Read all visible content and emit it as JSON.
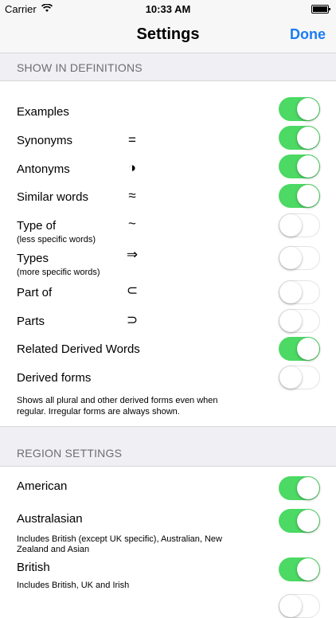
{
  "status_bar": {
    "carrier": "Carrier",
    "time": "10:33 AM"
  },
  "nav": {
    "title": "Settings",
    "done_label": "Done"
  },
  "definitions": {
    "header": "SHOW IN DEFINITIONS",
    "items": [
      {
        "label": "Examples",
        "symbol": "",
        "sub": "",
        "on": true
      },
      {
        "label": "Synonyms",
        "symbol": "=",
        "sub": "",
        "on": true
      },
      {
        "label": "Antonyms",
        "symbol": "◑",
        "sub": "",
        "on": true
      },
      {
        "label": "Similar words",
        "symbol": "≈",
        "sub": "",
        "on": true
      },
      {
        "label": "Type of",
        "symbol": "~",
        "sub": "(less specific words)",
        "on": false
      },
      {
        "label": "Types",
        "symbol": "⇒",
        "sub": "(more specific words)",
        "on": false
      },
      {
        "label": "Part of",
        "symbol": "⊂",
        "sub": "",
        "on": false
      },
      {
        "label": "Parts",
        "symbol": "⊃",
        "sub": "",
        "on": false
      },
      {
        "label": "Related Derived Words",
        "symbol": "",
        "sub": "",
        "on": true
      },
      {
        "label": "Derived forms",
        "symbol": "",
        "sub": "",
        "on": false
      }
    ],
    "footer": "Shows all plural and other derived forms even when regular. Irregular forms are always shown."
  },
  "region": {
    "header": "REGION SETTINGS",
    "items": [
      {
        "label": "American",
        "desc": "",
        "on": true
      },
      {
        "label": "Australasian",
        "desc": "Includes British (except UK specific), Australian, New Zealand and Asian",
        "on": true
      },
      {
        "label": "British",
        "desc": "Includes British, UK and Irish",
        "on": true
      }
    ]
  }
}
